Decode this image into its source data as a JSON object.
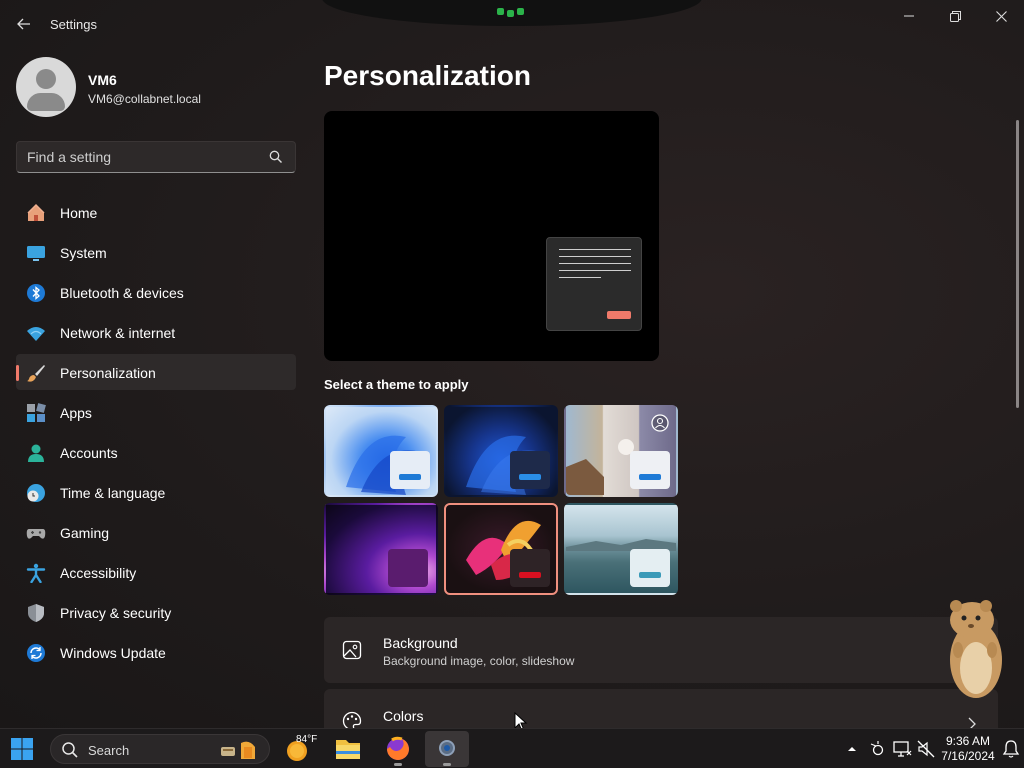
{
  "window": {
    "app_title": "Settings",
    "back_icon": "back-arrow-icon",
    "controls": [
      "minimize-icon",
      "restore-icon",
      "close-icon"
    ]
  },
  "user": {
    "name": "VM6",
    "email": "VM6@collabnet.local"
  },
  "search": {
    "placeholder": "Find a setting",
    "value": ""
  },
  "nav": {
    "items": [
      {
        "label": "Home",
        "icon": "home-icon"
      },
      {
        "label": "System",
        "icon": "monitor-icon"
      },
      {
        "label": "Bluetooth & devices",
        "icon": "bluetooth-icon"
      },
      {
        "label": "Network & internet",
        "icon": "wifi-icon"
      },
      {
        "label": "Personalization",
        "icon": "paintbrush-icon",
        "active": true
      },
      {
        "label": "Apps",
        "icon": "apps-icon"
      },
      {
        "label": "Accounts",
        "icon": "person-icon"
      },
      {
        "label": "Time & language",
        "icon": "clock-globe-icon"
      },
      {
        "label": "Gaming",
        "icon": "gamepad-icon"
      },
      {
        "label": "Accessibility",
        "icon": "accessibility-icon"
      },
      {
        "label": "Privacy & security",
        "icon": "shield-icon"
      },
      {
        "label": "Windows Update",
        "icon": "update-icon"
      }
    ]
  },
  "main": {
    "title": "Personalization",
    "theme_heading": "Select a theme to apply",
    "themes": [
      {
        "name": "windows-light",
        "selected": false
      },
      {
        "name": "windows-dark",
        "selected": false
      },
      {
        "name": "spotlight",
        "selected": false
      },
      {
        "name": "glow",
        "selected": false
      },
      {
        "name": "captured-motion",
        "selected": true
      },
      {
        "name": "flow",
        "selected": false
      }
    ],
    "rows": [
      {
        "title": "Background",
        "subtitle": "Background image, color, slideshow",
        "icon": "image-icon"
      },
      {
        "title": "Colors",
        "subtitle": "",
        "icon": "palette-icon"
      }
    ]
  },
  "taskbar": {
    "search_label": "Search",
    "weather_temp": "84°F",
    "time": "9:36 AM",
    "date": "7/16/2024",
    "apps": [
      "file-explorer-icon",
      "firefox-icon",
      "settings-icon"
    ]
  },
  "colors": {
    "accent": "#f07a6a",
    "background": "#201c1c",
    "card": "#2b2626"
  }
}
